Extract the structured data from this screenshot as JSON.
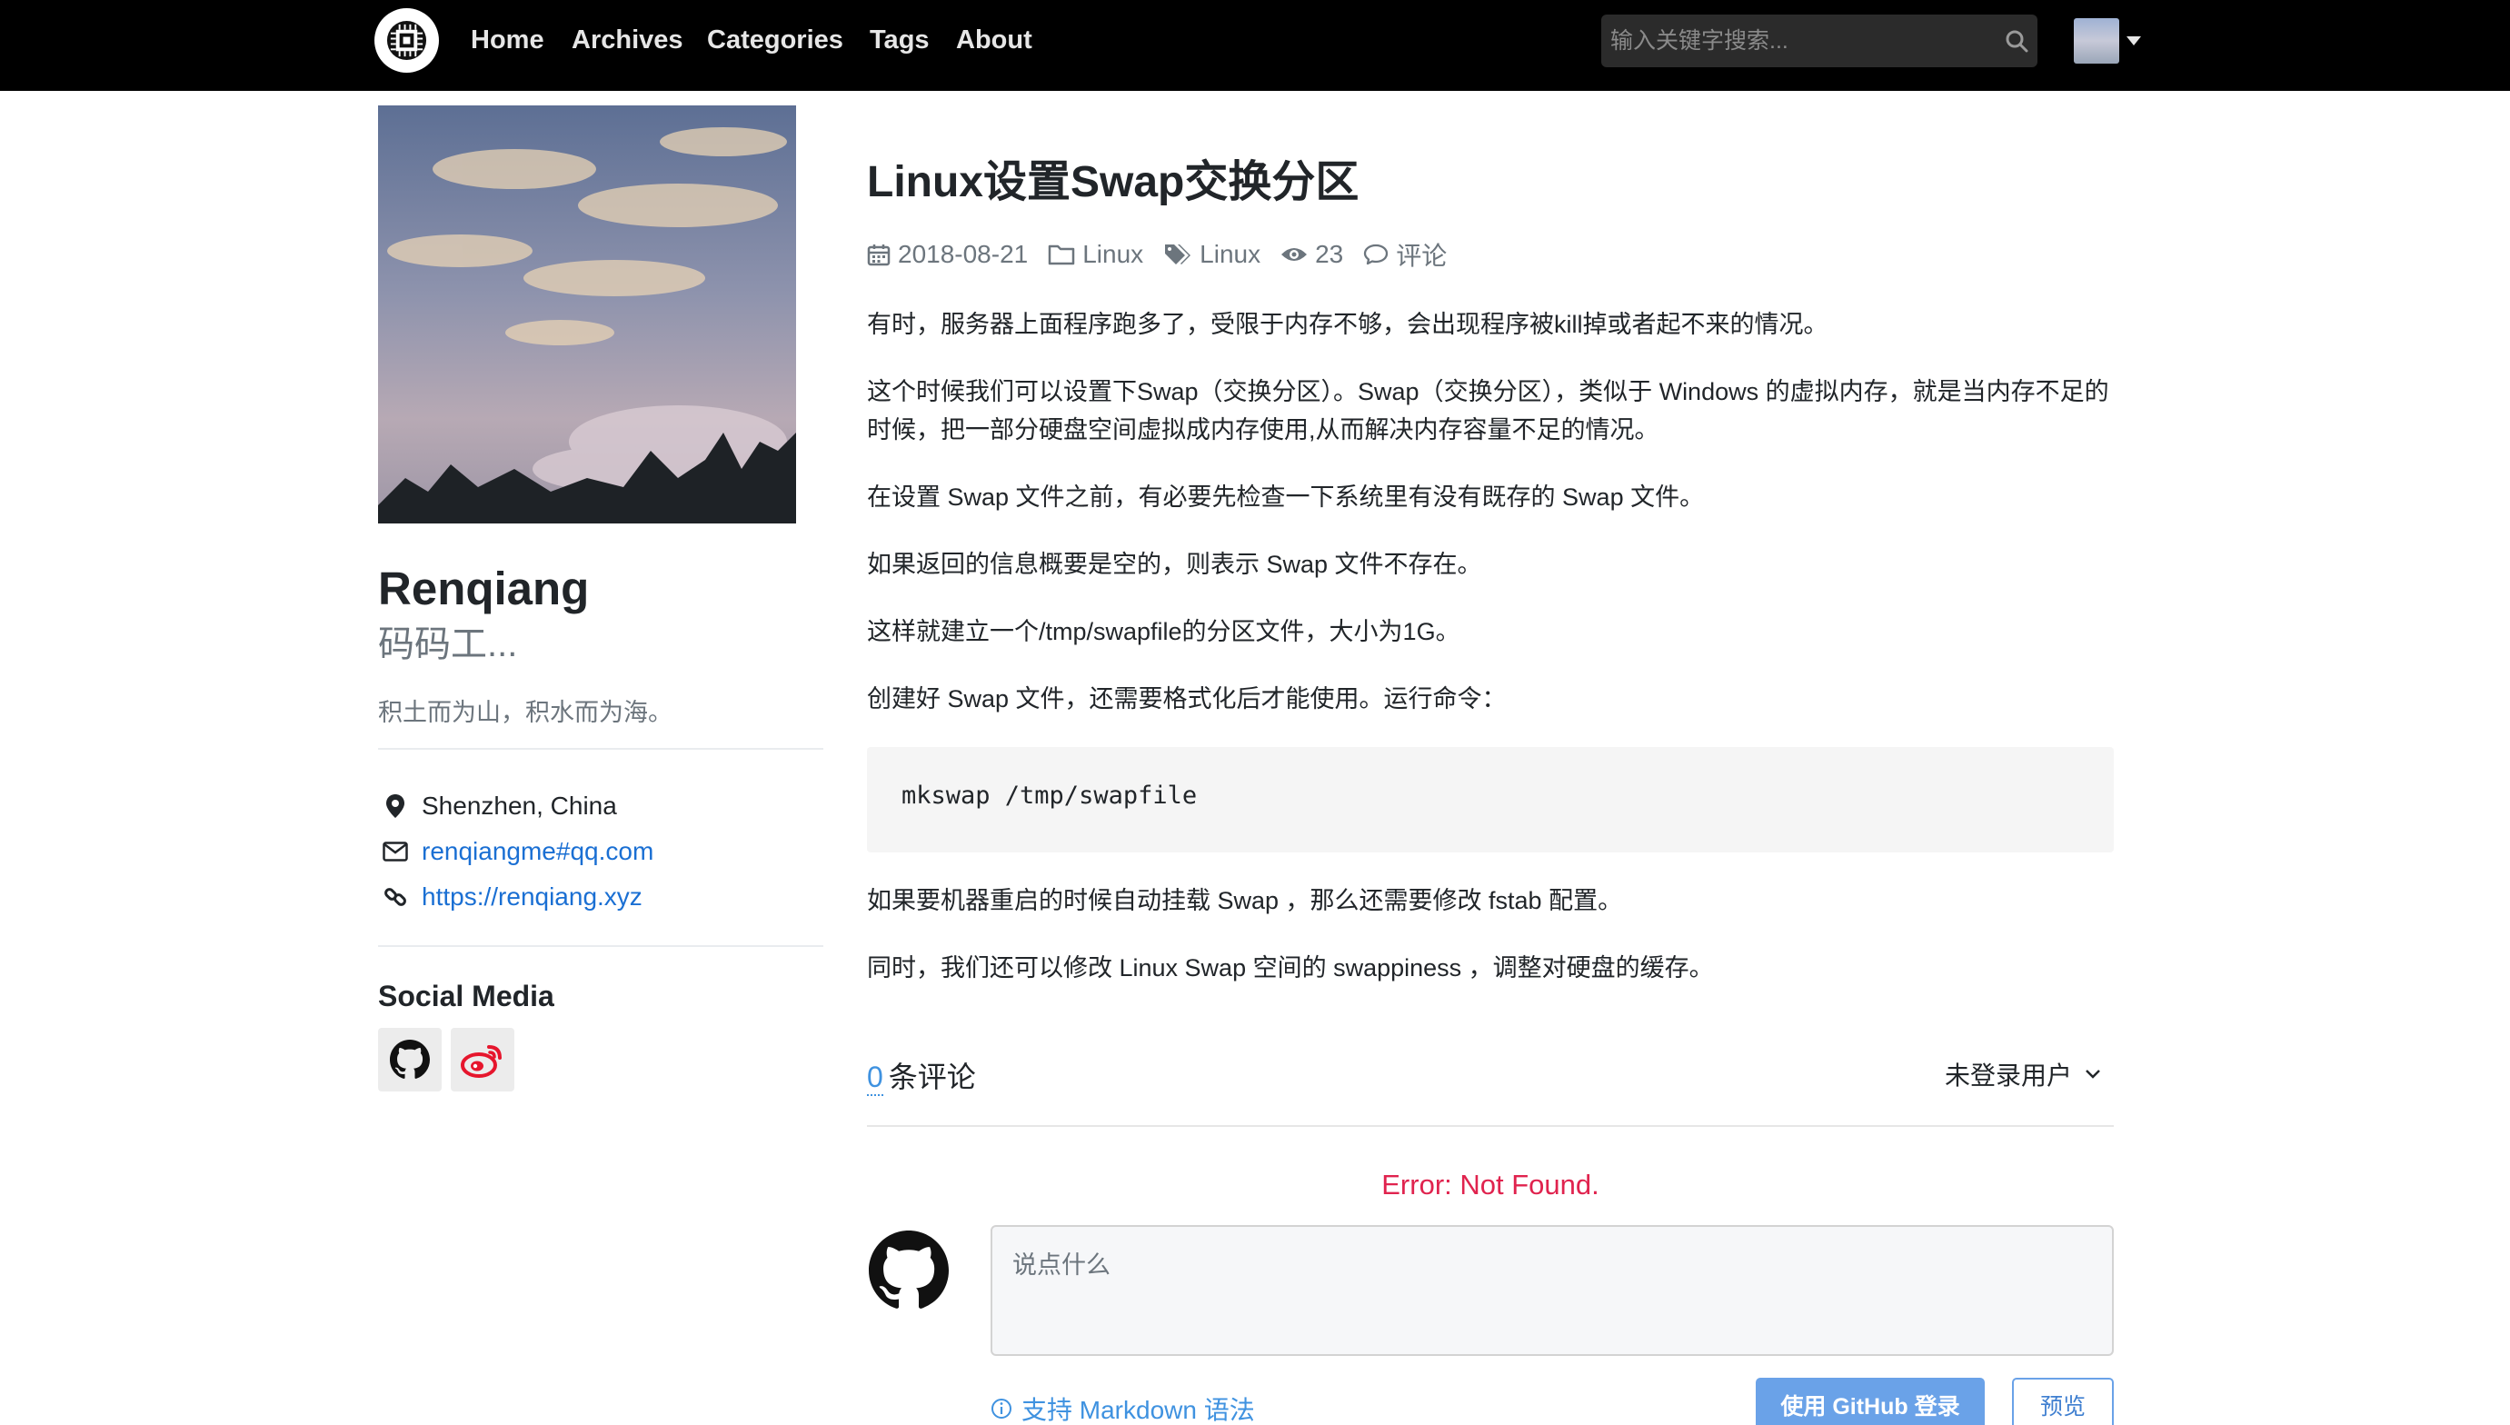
{
  "colors": {
    "navbar_bg": "#000000",
    "link": "#1a6fd3",
    "error": "#e0234e",
    "accent_button": "#6aa2e8",
    "code_bg": "#f5f5f5"
  },
  "nav": {
    "logo_icon": "chip-icon",
    "links": [
      "Home",
      "Archives",
      "Categories",
      "Tags",
      "About"
    ],
    "search_placeholder": "输入关键字搜索...",
    "search_icon": "search-icon"
  },
  "sidebar": {
    "name": "Renqiang",
    "subtitle": "码码工...",
    "motto": "积土而为山，积水而为海。",
    "location": "Shenzhen, China",
    "email": "renqiangme#qq.com",
    "website": "https://renqiang.xyz",
    "social_title": "Social Media",
    "social_icons": [
      "github-icon",
      "weibo-icon"
    ]
  },
  "post": {
    "title": "Linux设置Swap交换分区",
    "date": "2018-08-21",
    "category": "Linux",
    "tag": "Linux",
    "views": "23",
    "comments_label": "评论",
    "paragraphs": [
      "有时，服务器上面程序跑多了，受限于内存不够，会出现程序被kill掉或者起不来的情况。",
      "这个时候我们可以设置下Swap（交换分区）。Swap（交换分区），类似于 Windows 的虚拟内存，就是当内存不足的时候，把一部分硬盘空间虚拟成内存使用,从而解决内存容量不足的情况。",
      "在设置 Swap 文件之前，有必要先检查一下系统里有没有既存的 Swap 文件。",
      "如果返回的信息概要是空的，则表示 Swap 文件不存在。",
      "这样就建立一个/tmp/swapfile的分区文件，大小为1G。",
      "创建好 Swap 文件，还需要格式化后才能使用。运行命令："
    ],
    "code": "mkswap /tmp/swapfile",
    "paragraphs_after": [
      "如果要机器重启的时候自动挂载 Swap ，那么还需要修改 fstab 配置。",
      "同时，我们还可以修改 Linux Swap 空间的 swappiness ，调整对硬盘的缓存。"
    ]
  },
  "comments": {
    "count": "0",
    "count_label": "条评论",
    "login_status": "未登录用户",
    "error": "Error: Not Found.",
    "placeholder": "说点什么",
    "markdown_hint": "支持 Markdown 语法",
    "login_button": "使用 GitHub 登录",
    "preview_button": "预览"
  }
}
